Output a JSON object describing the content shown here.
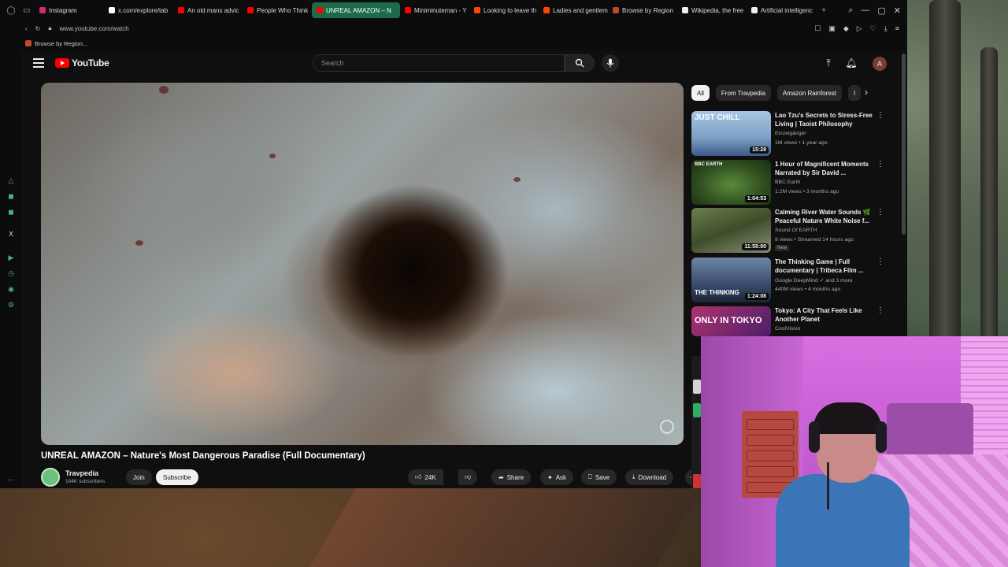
{
  "browser": {
    "tabs": [
      {
        "label": "Instagram",
        "color": "#d62976"
      },
      {
        "label": "x.com/explore/tab",
        "color": "#ffffff"
      },
      {
        "label": "An old mans advic",
        "color": "#ff0000"
      },
      {
        "label": "People Who Think",
        "color": "#ff0000"
      },
      {
        "label": "UNREAL AMAZON – N",
        "color": "#ff0000",
        "active": true
      },
      {
        "label": "Miniminuteman - Y",
        "color": "#ff0000"
      },
      {
        "label": "Looking to leave th",
        "color": "#ff4500"
      },
      {
        "label": "Ladies and gentlem",
        "color": "#ff4500"
      },
      {
        "label": "Browse by Region",
        "color": "#c24a2c"
      },
      {
        "label": "Wikipedia, the free",
        "color": "#eeeeee"
      },
      {
        "label": "Artificial intelligenc",
        "color": "#eeeeee"
      }
    ],
    "url": "www.youtube.com/watch",
    "bookmark": "Browse by Region..."
  },
  "youtube": {
    "logo": "YouTube",
    "search_placeholder": "Search",
    "avatar_letter": "A",
    "video_title": "UNREAL AMAZON – Nature's Most Dangerous Paradise (Full Documentary)",
    "channel": {
      "name": "Travpedia",
      "subs": "164K subscribers"
    },
    "actions": {
      "join": "Join",
      "subscribe": "Subscribe",
      "likes": "24K",
      "share": "Share",
      "ask": "Ask",
      "save": "Save",
      "download": "Download"
    },
    "chips": [
      "All",
      "From Travpedia",
      "Amazon Rainforest",
      "I"
    ],
    "recommendations": [
      {
        "title": "Lao Tzu's Secrets to Stress-Free Living | Taoist Philosophy",
        "channel": "Einzelgänger",
        "meta": "1M views • 1 year ago",
        "duration": "15:28",
        "thumb_text": "JUST CHILL",
        "thumb_color": "#8fb4d8"
      },
      {
        "title": "1 Hour of Magnificent Moments Narrated by Sir David ...",
        "channel": "BBC Earth",
        "meta": "1.2M views • 3 months ago",
        "duration": "1:04:53",
        "thumb_text": "BBC EARTH",
        "thumb_color": "#3f6b2c"
      },
      {
        "title": "Calming River Water Sounds 🌿 Peaceful Nature White Noise f...",
        "channel": "Sound Of EARTH",
        "meta": "8 views • Streamed 14 hours ago",
        "badge": "New",
        "duration": "11:55:00",
        "thumb_text": "",
        "thumb_color": "#556b3c"
      },
      {
        "title": "The Thinking Game | Full documentary | Tribeca Film ...",
        "channel": "Google DeepMind",
        "channel_extra": "and 3 more",
        "meta": "440M views • 4 months ago",
        "duration": "1:24:08",
        "thumb_text": "THE THINKING",
        "thumb_color": "#3a4a66"
      },
      {
        "title": "Tokyo: A City That Feels Like Another Planet",
        "channel": "CoolVision",
        "meta": "",
        "duration": "",
        "thumb_text": "ONLY IN TOKYO",
        "thumb_color": "#7a2a6a"
      }
    ]
  }
}
